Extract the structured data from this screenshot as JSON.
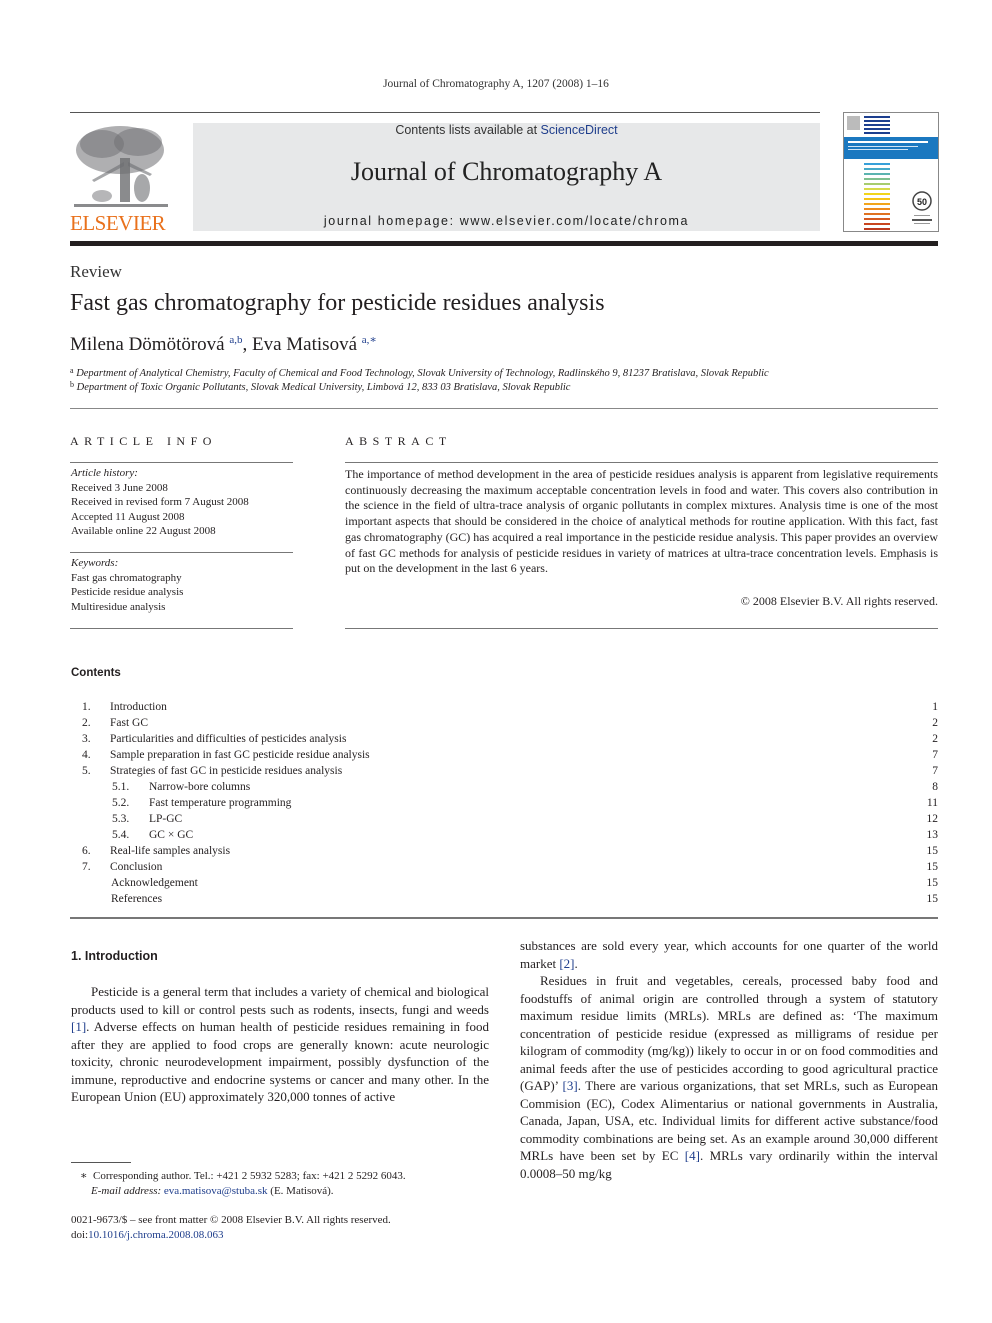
{
  "running_header": "Journal of Chromatography A, 1207 (2008) 1–16",
  "masthead": {
    "publisher_logo": "ELSEVIER",
    "contents_prefix": "Contents lists available at ",
    "contents_link": "ScienceDirect",
    "journal_name": "Journal of Chromatography A",
    "homepage_prefix": "journal homepage: ",
    "homepage_url": "www.elsevier.com/locate/chroma",
    "colors": {
      "brand_orange": "#e9711c",
      "link_blue": "#1f3e8c",
      "banner_gray": "#e7e8e9"
    }
  },
  "article": {
    "type": "Review",
    "title": "Fast gas chromatography for pesticide residues analysis",
    "authors": [
      {
        "name": "Milena Dömötörová",
        "affil": "a,b"
      },
      {
        "name": "Eva Matisová",
        "affil": "a,∗"
      }
    ],
    "author_separator": ", ",
    "affiliations": [
      {
        "mark": "a",
        "text": "Department of Analytical Chemistry, Faculty of Chemical and Food Technology, Slovak University of Technology, Radlinského 9, 81237 Bratislava, Slovak Republic"
      },
      {
        "mark": "b",
        "text": "Department of Toxic Organic Pollutants, Slovak Medical University, Limbová 12, 833 03 Bratislava, Slovak Republic"
      }
    ]
  },
  "article_info": {
    "heading": "ARTICLE INFO",
    "history_label": "Article history:",
    "history": [
      "Received 3 June 2008",
      "Received in revised form 7 August 2008",
      "Accepted 11 August 2008",
      "Available online 22 August 2008"
    ],
    "keywords_label": "Keywords:",
    "keywords": [
      "Fast gas chromatography",
      "Pesticide residue analysis",
      "Multiresidue analysis"
    ]
  },
  "abstract": {
    "heading": "ABSTRACT",
    "text": "The importance of method development in the area of pesticide residues analysis is apparent from legislative requirements continuously decreasing the maximum acceptable concentration levels in food and water. This covers also contribution in the science in the field of ultra-trace analysis of organic pollutants in complex mixtures. Analysis time is one of the most important aspects that should be considered in the choice of analytical methods for routine application. With this fact, fast gas chromatography (GC) has acquired a real importance in the pesticide residue analysis. This paper provides an overview of fast GC methods for analysis of pesticide residues in variety of matrices at ultra-trace concentration levels. Emphasis is put on the development in the last 6 years.",
    "copyright": "© 2008 Elsevier B.V. All rights reserved."
  },
  "contents": {
    "heading": "Contents",
    "items": [
      {
        "num": "1.",
        "title": "Introduction",
        "page": "1",
        "level": 1
      },
      {
        "num": "2.",
        "title": "Fast GC",
        "page": "2",
        "level": 1
      },
      {
        "num": "3.",
        "title": "Particularities and difficulties of pesticides analysis",
        "page": "2",
        "level": 1
      },
      {
        "num": "4.",
        "title": "Sample preparation in fast GC pesticide residue analysis",
        "page": "7",
        "level": 1
      },
      {
        "num": "5.",
        "title": "Strategies of fast GC in pesticide residues analysis",
        "page": "7",
        "level": 1
      },
      {
        "num": "5.1.",
        "title": "Narrow-bore columns",
        "page": "8",
        "level": 2
      },
      {
        "num": "5.2.",
        "title": "Fast temperature programming",
        "page": "11",
        "level": 2
      },
      {
        "num": "5.3.",
        "title": "LP-GC",
        "page": "12",
        "level": 2
      },
      {
        "num": "5.4.",
        "title": "GC × GC",
        "page": "13",
        "level": 2
      },
      {
        "num": "6.",
        "title": "Real-life samples analysis",
        "page": "15",
        "level": 1
      },
      {
        "num": "7.",
        "title": "Conclusion",
        "page": "15",
        "level": 1
      },
      {
        "num": "",
        "title": "Acknowledgement",
        "page": "15",
        "level": 0
      },
      {
        "num": "",
        "title": "References",
        "page": "15",
        "level": 0
      }
    ]
  },
  "body": {
    "section1_heading": "1.  Introduction",
    "left_para": {
      "t1": "Pesticide is a general term that includes a variety of chemical and biological products used to kill or control pests such as rodents, insects, fungi and weeds ",
      "ref1": "[1]",
      "t2": ". Adverse effects on human health of pesticide residues remaining in food after they are applied to food crops are generally known: acute neurologic toxicity, chronic neurodevelopment impairment, possibly dysfunction of the immune, reproductive and endocrine systems or cancer and many other. In the European Union (EU) approximately 320,000 tonnes of active"
    },
    "right_para1": {
      "t1": "substances are sold every year, which accounts for one quarter of the world market ",
      "ref": "[2]",
      "t2": "."
    },
    "right_para2": {
      "t1": "Residues in fruit and vegetables, cereals, processed baby food and foodstuffs of animal origin are controlled through a system of statutory maximum residue limits (MRLs). MRLs are defined as: ‘The maximum concentration of pesticide residue (expressed as milligrams of residue per kilogram of commodity (mg/kg)) likely to occur in or on food commodities and animal feeds after the use of pesticides according to good agricultural practice (GAP)’ ",
      "ref3": "[3]",
      "t2": ". There are various organizations, that set MRLs, such as European Commision (EC), Codex Alimentarius or national governments in Australia, Canada, Japan, USA, etc. Individual limits for different active substance/food commodity combinations are being set. As an example around 30,000 different MRLs have been set by EC ",
      "ref4": "[4]",
      "t3": ". MRLs vary ordinarily within the interval 0.0008–50 mg/kg"
    }
  },
  "footnote": {
    "mark": "∗",
    "corresponding": "Corresponding author. Tel.: +421 2 5932 5283; fax: +421 2 5292 6043.",
    "email_label": "E-mail address:",
    "email": "eva.matisova@stuba.sk",
    "email_suffix": " (E. Matisová)."
  },
  "front_matter": {
    "line1": "0021-9673/$ – see front matter © 2008 Elsevier B.V. All rights reserved.",
    "doi_prefix": "doi:",
    "doi": "10.1016/j.chroma.2008.08.063"
  }
}
